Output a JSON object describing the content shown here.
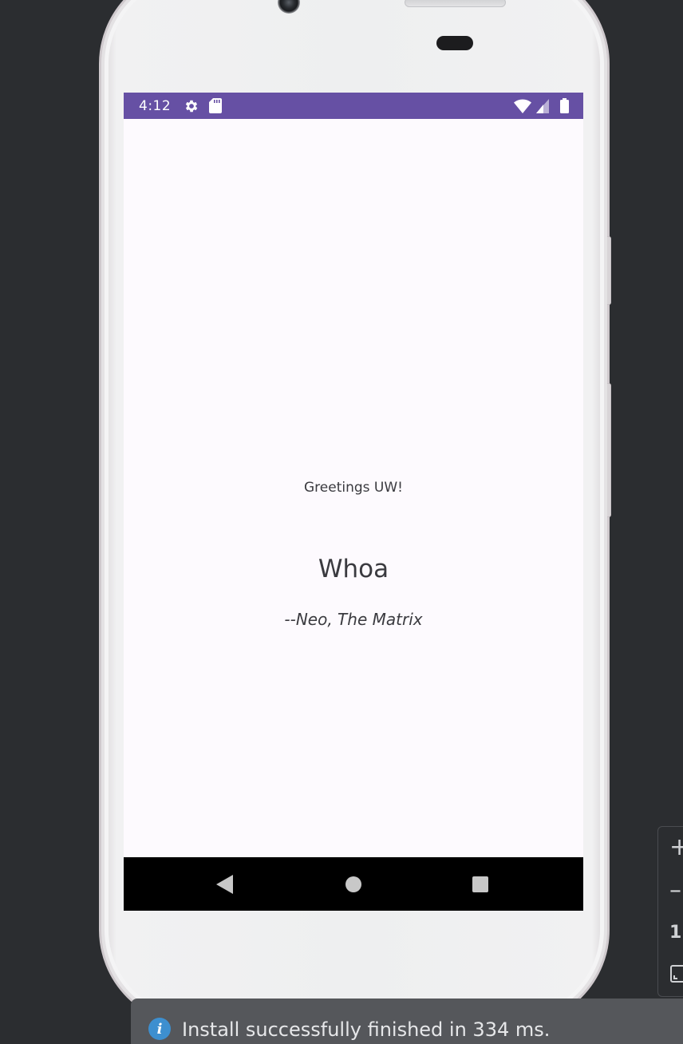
{
  "status_bar": {
    "time": "4:12",
    "left_icons": [
      "gear-icon",
      "sd-card-icon"
    ],
    "right_icons": [
      "wifi-icon",
      "cell-signal-icon",
      "battery-icon"
    ],
    "color": "#6650a4"
  },
  "app": {
    "greeting": "Greetings UW!",
    "quote": "Whoa",
    "attribution": "--Neo, The Matrix"
  },
  "nav_bar": {
    "buttons": [
      "back-icon",
      "home-icon",
      "recents-icon"
    ]
  },
  "emulator_toolbar": {
    "zoom_in": "+",
    "zoom_out": "–",
    "zoom_ratio": "1:"
  },
  "notification": {
    "icon": "info-icon",
    "icon_glyph": "i",
    "message": "Install successfully finished in 334 ms."
  }
}
